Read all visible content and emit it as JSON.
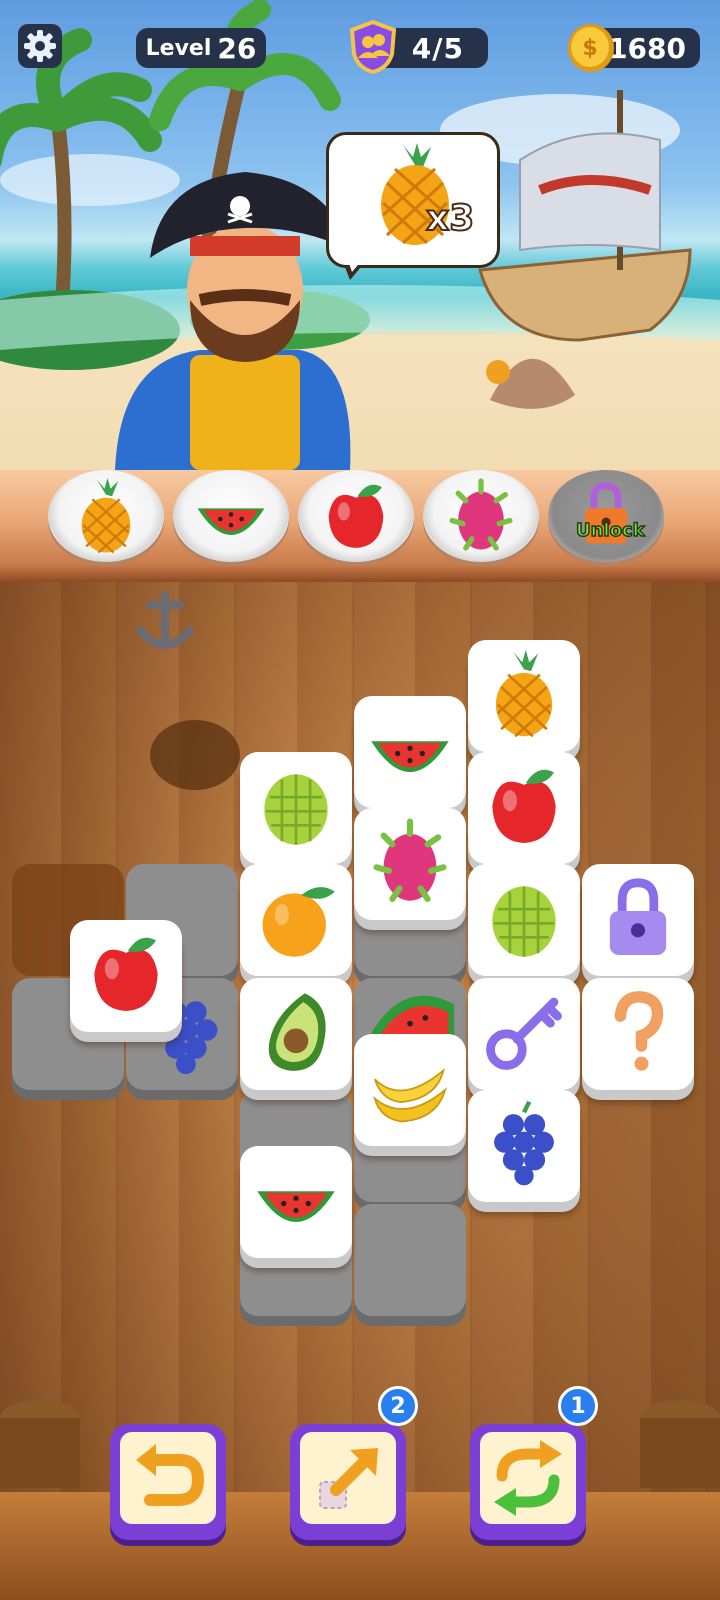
{
  "hud": {
    "level_label": "Level",
    "level_number": "26",
    "goals": "4/5",
    "coins": "1680"
  },
  "order": {
    "fruit": "pineapple",
    "count": "x3"
  },
  "tray": {
    "slots": [
      "pineapple",
      "watermelon",
      "apple",
      "dragonfruit"
    ],
    "locked_label": "Unlock"
  },
  "board": {
    "tiles": [
      "pineapple",
      "watermelon",
      "apple",
      "durian",
      "dragonfruit",
      "orange",
      "durian",
      "lock",
      "apple",
      "avocado",
      "key",
      "question",
      "banana",
      "grapes",
      "watermelon"
    ]
  },
  "tools": {
    "undo": {
      "icon": "undo-icon"
    },
    "move_out": {
      "icon": "move-out-icon",
      "count": "2"
    },
    "shuffle": {
      "icon": "shuffle-icon",
      "count": "1"
    }
  },
  "colors": {
    "hud_bg": "#26324a",
    "tool_frame": "#7b3fd6",
    "badge": "#2a7ff0"
  }
}
